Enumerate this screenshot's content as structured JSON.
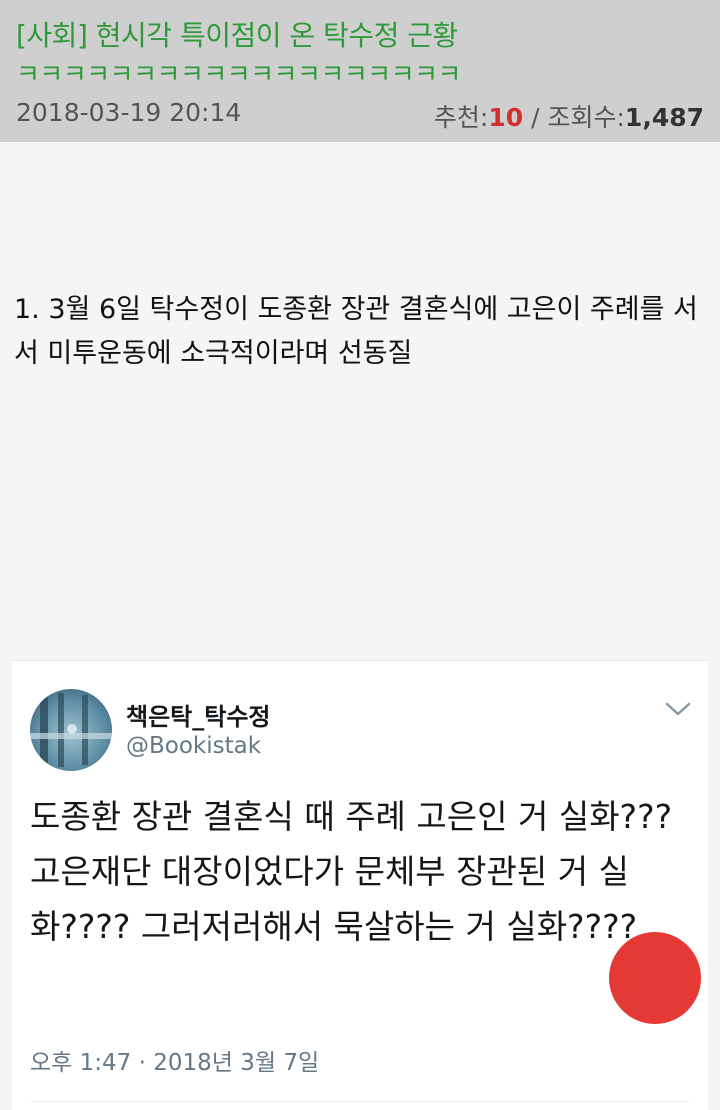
{
  "post": {
    "title": "[사회] 현시각 특이점이 온 탁수정 근황",
    "subtitle": "ㅋㅋㅋㅋㅋㅋㅋㅋㅋㅋㅋㅋㅋㅋㅋㅋㅋㅋㅋ",
    "date": "2018-03-19 20:14",
    "recommend_label": "추천:",
    "recommend_value": "10",
    "separator": " / ",
    "views_label": "조회수:",
    "views_value": "1,487",
    "body_text": "1. 3월 6일 탁수정이 도종환 장관 결혼식에 고은이 주례를 서서 미투운동에 소극적이라며 선동질"
  },
  "tweet": {
    "author_name": "책은탁_탁수정",
    "author_handle": "@Bookistak",
    "text": "도종환 장관 결혼식 때 주례 고은인 거 실화??? 고은재단 대장이었다가 문체부 장관된 거 실화???? 그러저러해서 묵살하는 거 실화????",
    "timestamp": "오후 1:47 · 2018년 3월 7일",
    "avatar_icon": "avatar-photo",
    "menu_icon": "chevron-down-icon"
  },
  "colors": {
    "header_bg": "#cfcfcf",
    "title_green": "#2e9a3a",
    "recommend_red": "#d32f2f",
    "fab_red": "#e53935"
  }
}
